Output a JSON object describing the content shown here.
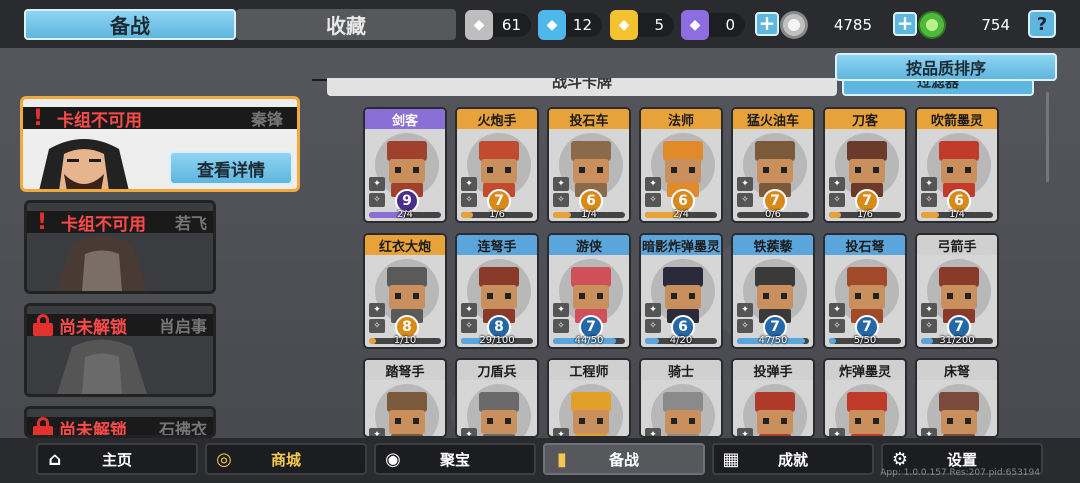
{
  "top_tabs": {
    "prepare": "备战",
    "collection": "收藏"
  },
  "resources": [
    {
      "name": "silver-shard",
      "value": "61",
      "color": "#c8c8c8"
    },
    {
      "name": "blue-shard",
      "value": "12",
      "color": "#4fb8ea"
    },
    {
      "name": "gold-shard",
      "value": "5",
      "color": "#f2c230"
    },
    {
      "name": "purple-shard",
      "value": "0",
      "color": "#8d6ee0"
    }
  ],
  "currency": {
    "silver": "4785",
    "gold": "754"
  },
  "help_label": "?",
  "sort_button": "按品质排序",
  "filter_button": "过滤器",
  "section_title": "战斗卡牌",
  "heroes": [
    {
      "status": "卡组不可用",
      "name": "秦锋",
      "detail": "查看详情"
    },
    {
      "status": "卡组不可用",
      "name": "若飞"
    },
    {
      "status": "尚未解锁",
      "name": "肖启事"
    },
    {
      "status": "尚未解锁",
      "name": "石拂衣"
    }
  ],
  "cards": [
    {
      "name": "剑客",
      "cost": "9",
      "progress": "2/4",
      "fill": 0.5,
      "tier": "purple"
    },
    {
      "name": "火炮手",
      "cost": "7",
      "progress": "1/6",
      "fill": 0.17,
      "tier": "orange"
    },
    {
      "name": "投石车",
      "cost": "6",
      "progress": "1/4",
      "fill": 0.25,
      "tier": "orange"
    },
    {
      "name": "法师",
      "cost": "6",
      "progress": "2/4",
      "fill": 0.5,
      "tier": "orange"
    },
    {
      "name": "猛火油车",
      "cost": "7",
      "progress": "0/6",
      "fill": 0.0,
      "tier": "orange"
    },
    {
      "name": "刀客",
      "cost": "7",
      "progress": "1/6",
      "fill": 0.17,
      "tier": "orange"
    },
    {
      "name": "吹箭墨灵",
      "cost": "6",
      "progress": "1/4",
      "fill": 0.25,
      "tier": "orange"
    },
    {
      "name": "红衣大炮",
      "cost": "8",
      "progress": "1/10",
      "fill": 0.1,
      "tier": "orange"
    },
    {
      "name": "连弩手",
      "cost": "8",
      "progress": "29/100",
      "fill": 0.29,
      "tier": "blue"
    },
    {
      "name": "游侠",
      "cost": "7",
      "progress": "44/50",
      "fill": 0.88,
      "tier": "blue"
    },
    {
      "name": "暗影炸弹墨灵",
      "cost": "6",
      "progress": "4/20",
      "fill": 0.2,
      "tier": "blue"
    },
    {
      "name": "铁蒺藜",
      "cost": "7",
      "progress": "47/50",
      "fill": 0.94,
      "tier": "blue"
    },
    {
      "name": "投石弩",
      "cost": "7",
      "progress": "5/50",
      "fill": 0.1,
      "tier": "blue"
    },
    {
      "name": "弓箭手",
      "cost": "7",
      "progress": "31/200",
      "fill": 0.16,
      "tier": "gray"
    },
    {
      "name": "踏弩手",
      "tier": "gray"
    },
    {
      "name": "刀盾兵",
      "tier": "gray"
    },
    {
      "name": "工程师",
      "tier": "gray"
    },
    {
      "name": "骑士",
      "tier": "gray"
    },
    {
      "name": "投弹手",
      "tier": "gray"
    },
    {
      "name": "炸弹墨灵",
      "tier": "gray"
    },
    {
      "name": "床弩",
      "tier": "gray"
    }
  ],
  "bottom_nav": [
    {
      "label": "主页",
      "icon": "home-icon"
    },
    {
      "label": "商城",
      "icon": "coins-icon"
    },
    {
      "label": "聚宝",
      "icon": "treasure-icon"
    },
    {
      "label": "备战",
      "icon": "card-icon"
    },
    {
      "label": "成就",
      "icon": "achievement-icon"
    },
    {
      "label": "设置",
      "icon": "gear-icon"
    }
  ],
  "version": "App: 1.0.0.157 Res:207 pid:653194"
}
